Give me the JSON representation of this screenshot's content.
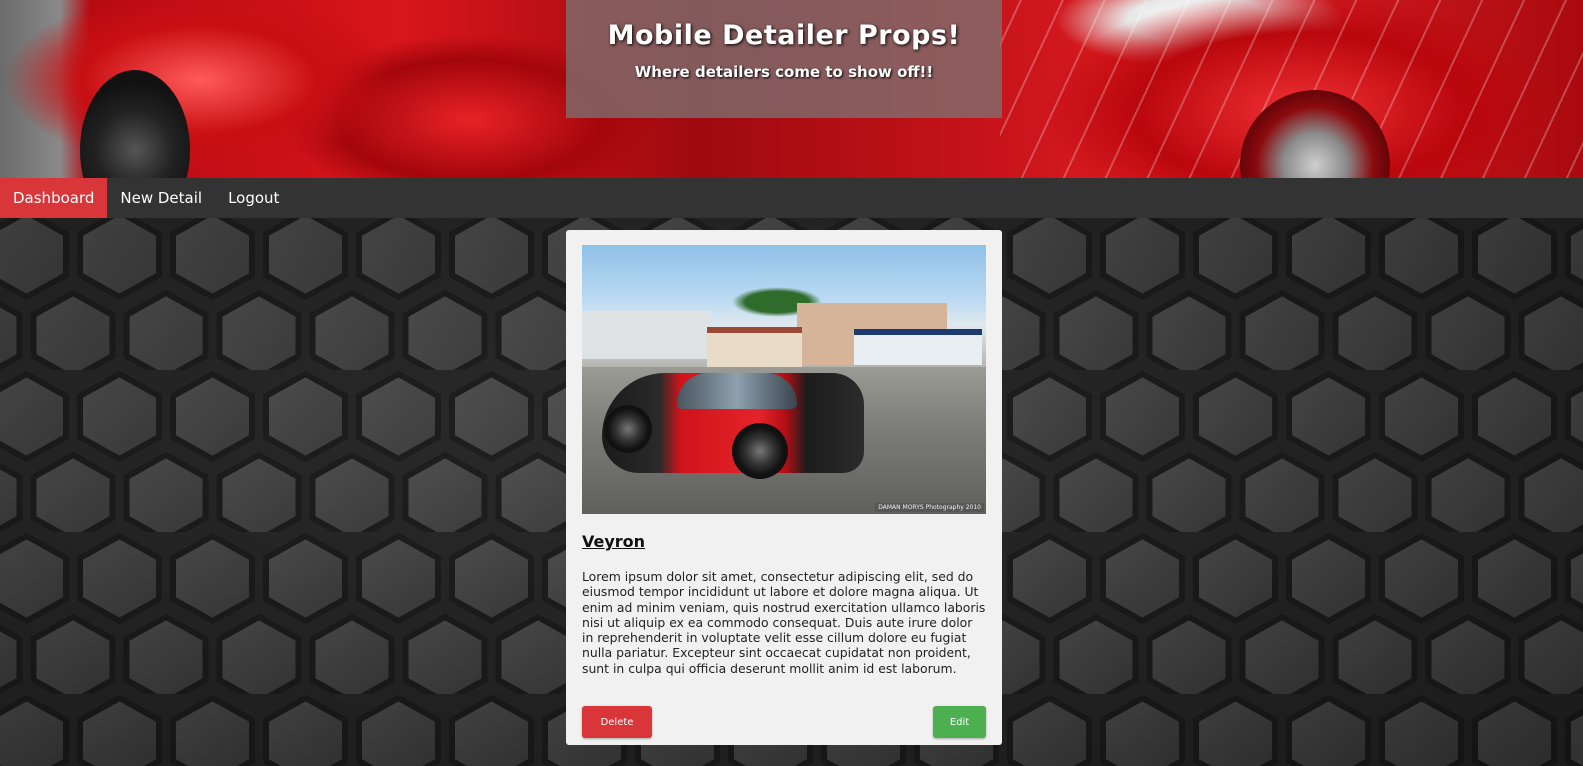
{
  "header": {
    "title": "Mobile Detailer Props!",
    "subtitle": "Where detailers come to show off!!"
  },
  "nav": {
    "items": [
      {
        "label": "Dashboard",
        "active": true
      },
      {
        "label": "New Detail",
        "active": false
      },
      {
        "label": "Logout",
        "active": false
      }
    ]
  },
  "card": {
    "image_credit": "DAMAN MORYS Photography 2010",
    "car_name": "Veyron",
    "description": "Lorem ipsum dolor sit amet, consectetur adipiscing elit, sed do eiusmod tempor incididunt ut labore et dolore magna aliqua. Ut enim ad minim veniam, quis nostrud exercitation ullamco laboris nisi ut aliquip ex ea commodo consequat. Duis aute irure dolor in reprehenderit in voluptate velit esse cillum dolore eu fugiat nulla pariatur. Excepteur sint occaecat cupidatat non proident, sunt in culpa qui officia deserunt mollit anim id est laborum.",
    "delete_label": "Delete",
    "edit_label": "Edit"
  },
  "colors": {
    "accent_red": "#d9363a",
    "edit_green": "#4caf50",
    "nav_bg": "#333333"
  }
}
